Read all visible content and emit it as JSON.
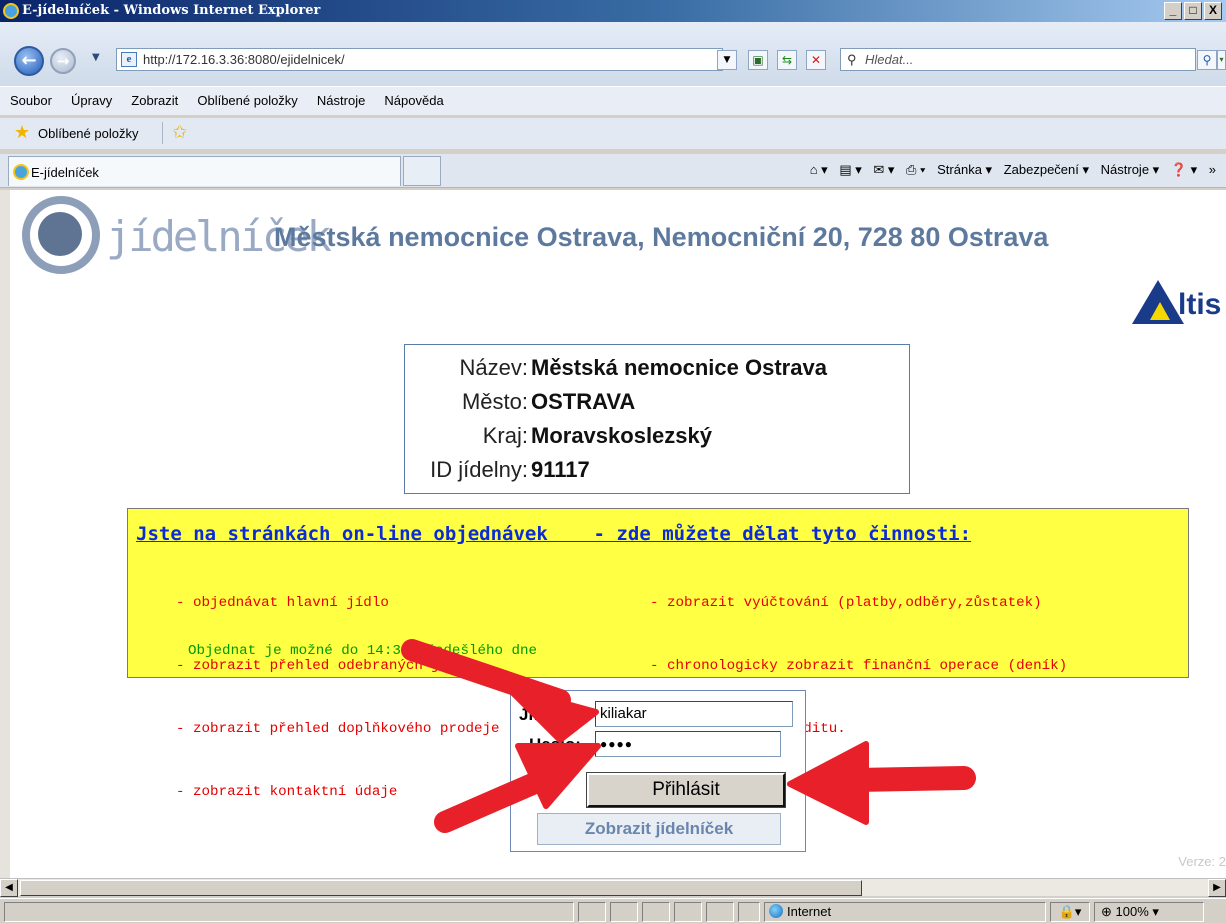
{
  "window": {
    "title": "E-jídelníček - Windows Internet Explorer",
    "min_label": "_",
    "max_label": "□",
    "close_label": "X"
  },
  "addressbar": {
    "url": "http://172.16.3.36:8080/ejidelnicek/",
    "search_placeholder": "Hledat..."
  },
  "menu": [
    "Soubor",
    "Úpravy",
    "Zobrazit",
    "Oblíbené položky",
    "Nástroje",
    "Nápověda"
  ],
  "favorites": {
    "label": "Oblíbené položky"
  },
  "tab": {
    "label": "E-jídelníček"
  },
  "commandbar": {
    "page": "Stránka ▾",
    "security": "Zabezpečení ▾",
    "tools": "Nástroje ▾"
  },
  "page": {
    "logo_text": "jídelníček",
    "hospital_title": "Městská nemocnice Ostrava, Nemocniční 20, 728 80 Ostrava",
    "altis_logo": "ltis",
    "info": [
      {
        "label": "Název:",
        "value": "Městská nemocnice Ostrava"
      },
      {
        "label": "Město:",
        "value": "OSTRAVA"
      },
      {
        "label": "Kraj:",
        "value": "Moravskoslezský"
      },
      {
        "label": "ID jídelny:",
        "value": "91117"
      }
    ],
    "notice": {
      "heading": "Jste na stránkách on-line objednávek    - zde můžete dělat tyto činnosti:",
      "left_items": [
        "- objednávat hlavní jídlo",
        "- zobrazit přehled odebraných jídel",
        "- zobrazit přehled doplňkového prodeje",
        "- zobrazit kontaktní údaje"
      ],
      "right_items": [
        "- zobrazit vyúčtování (platby,odběry,zůstatek)",
        "- chronologicky zobrazit finanční operace (deník)",
        "- zjistit výši kreditu."
      ],
      "deadline": "Objednat je možné do 14:30 předešlého dne"
    },
    "login": {
      "name_label": "Jméno:",
      "name_value": "kiliakar",
      "password_label": "Heslo:",
      "password_value": "●●●●",
      "login_button": "Přihlásit",
      "menu_button": "Zobrazit jídelníček"
    },
    "version": "Verze: 2"
  },
  "statusbar": {
    "zone": "Internet",
    "zoom": "100%"
  },
  "colors": {
    "arrow": "#e8202a",
    "notice_bg": "#ffff44",
    "heading_blue": "#0a2bd6",
    "item_red": "#e60000",
    "deadline_green": "#009a00"
  }
}
